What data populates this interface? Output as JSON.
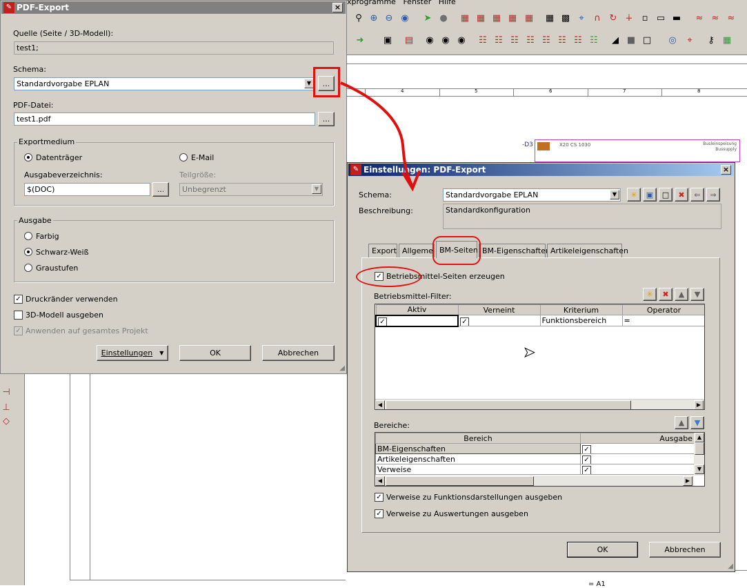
{
  "colors": {
    "title_active": "#0a246a",
    "title_inactive": "#808080",
    "accent_red": "#e01010",
    "dialog_bg": "#d4d0c8"
  },
  "menubar": {
    "items": [
      "xprogramme",
      "Fenster",
      "Hilfe"
    ]
  },
  "pdf_export": {
    "title": "PDF-Export",
    "source_label": "Quelle (Seite / 3D-Modell):",
    "source_value": "test1;",
    "schema_label": "Schema:",
    "schema_value": "Standardvorgabe EPLAN",
    "pdffile_label": "PDF-Datei:",
    "pdffile_value": "test1.pdf",
    "ellipsis": "...",
    "medium_group": "Exportmedium",
    "medium_data": "Datenträger",
    "medium_email": "E-Mail",
    "outdir_label": "Ausgabeverzeichnis:",
    "outdir_value": "$(DOC)",
    "partsize_label": "Teilgröße:",
    "partsize_value": "Unbegrenzt",
    "output_group": "Ausgabe",
    "out_color": "Farbig",
    "out_bw": "Schwarz-Weiß",
    "out_gray": "Graustufen",
    "chk_margins": "Druckränder verwenden",
    "chk_3d": "3D-Modell ausgeben",
    "chk_project": "Anwenden auf gesamtes Projekt",
    "btn_settings": "Einstellungen",
    "btn_ok": "OK",
    "btn_cancel": "Abbrechen"
  },
  "drawing": {
    "ruler": [
      "4",
      "5",
      "6",
      "7",
      "8"
    ],
    "device_label": "-D3",
    "device_text": "X20 CS 1030",
    "device_right1": "Busleinspeisung",
    "device_right2": "Bussupply"
  },
  "settings": {
    "title": "Einstellungen: PDF-Export",
    "schema_label": "Schema:",
    "schema_value": "Standardvorgabe EPLAN",
    "desc_label": "Beschreibung:",
    "desc_value": "Standardkonfiguration",
    "tabs": [
      "Export",
      "Allgemein",
      "BM-Seiten",
      "BM-Eigenschaften",
      "Artikeleigenschaften"
    ],
    "chk_generate": "Betriebsmittel-Seiten erzeugen",
    "filter_label": "Betriebsmittel-Filter:",
    "filter_headers": [
      "Aktiv",
      "Verneint",
      "Kriterium",
      "Operator"
    ],
    "filter_row": {
      "kriterium": "Funktionsbereich",
      "operator": "="
    },
    "areas_label": "Bereiche:",
    "areas_headers": [
      "Bereich",
      "Ausgabe"
    ],
    "areas_rows": [
      "BM-Eigenschaften",
      "Artikeleigenschaften",
      "Verweise"
    ],
    "chk_func": "Verweise zu Funktionsdarstellungen ausgeben",
    "chk_eval": "Verweise zu Auswertungen ausgeben",
    "btn_ok": "OK",
    "btn_cancel": "Abbrechen"
  },
  "statusbar": {
    "label": "= A1"
  }
}
